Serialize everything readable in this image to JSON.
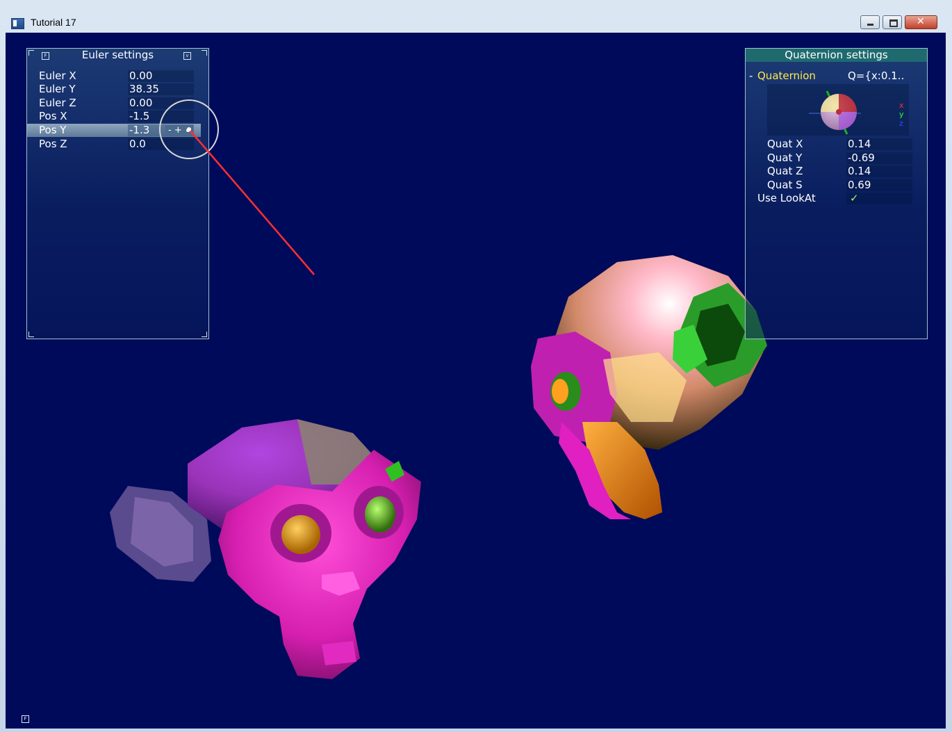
{
  "window": {
    "title": "Tutorial 17"
  },
  "euler_bar": {
    "title": "Euler settings",
    "rows": [
      {
        "label": "Euler X",
        "value": "0.00"
      },
      {
        "label": "Euler Y",
        "value": "38.35"
      },
      {
        "label": "Euler Z",
        "value": "0.00"
      },
      {
        "label": "Pos X",
        "value": "-1.5"
      },
      {
        "label": "Pos Y",
        "value": "-1.3"
      },
      {
        "label": "Pos Z",
        "value": "0.0"
      }
    ],
    "spin_label": "- +",
    "icon_left": "F",
    "icon_right": "v"
  },
  "quat_bar": {
    "title": "Quaternion settings",
    "group_toggle": "-",
    "group_label": "Quaternion",
    "group_value": "Q={x:0.1..",
    "axes": {
      "x": "x",
      "y": "y",
      "z": "z"
    },
    "rows": [
      {
        "label": "Quat X",
        "value": "0.14"
      },
      {
        "label": "Quat Y",
        "value": "-0.69"
      },
      {
        "label": "Quat Z",
        "value": "0.14"
      },
      {
        "label": "Quat S",
        "value": "0.69"
      }
    ],
    "lookat_label": "Use LookAt",
    "lookat_value": "✓"
  },
  "colors": {
    "background": "#000a5a",
    "group_label": "#ffe94a",
    "check": "#9cff5a",
    "pointer_line": "#ff3030"
  },
  "corner_icon": "F"
}
